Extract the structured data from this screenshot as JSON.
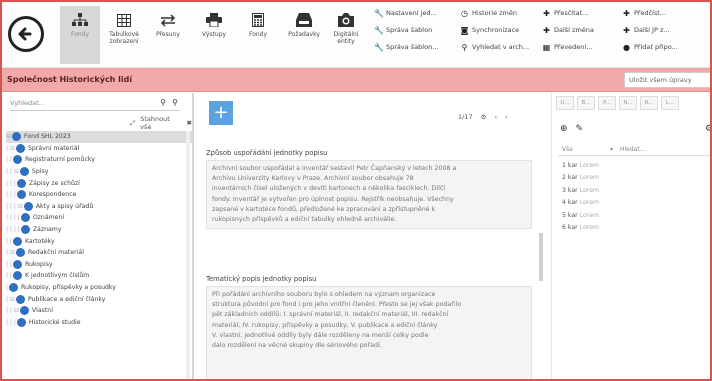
{
  "toolbar": {
    "buttons": [
      {
        "id": "fondy",
        "label": "Fondy",
        "icon": "hierarchy-icon",
        "active": true
      },
      {
        "id": "tabulkove",
        "label": "Tabulkové zobrazení",
        "icon": "table-icon",
        "active": false
      },
      {
        "id": "presuny",
        "label": "Přesuny",
        "icon": "transfer-icon",
        "active": false
      },
      {
        "id": "vystupy",
        "label": "Výstupy",
        "icon": "printer-icon",
        "active": false
      },
      {
        "id": "fondy2",
        "label": "Fondy",
        "icon": "calculator-icon",
        "active": false
      },
      {
        "id": "pozadavky",
        "label": "Požadavky",
        "icon": "inbox-icon",
        "active": false
      },
      {
        "id": "digitalni",
        "label": "Digitální entity",
        "icon": "camera-icon",
        "active": false
      }
    ],
    "menu_columns": [
      [
        {
          "icon": "wrench-icon",
          "label": "Nastavení jed..."
        },
        {
          "icon": "wrench-icon",
          "label": "Správa šablon"
        },
        {
          "icon": "wrench-icon",
          "label": "Správa šablon..."
        }
      ],
      [
        {
          "icon": "clock-icon",
          "label": "Historie změn"
        },
        {
          "icon": "camera-icon",
          "label": "Synchronizace"
        },
        {
          "icon": "search-icon",
          "label": "Vyhledat v arch..."
        }
      ],
      [
        {
          "icon": "plus-icon",
          "label": "Přesčítat..."
        },
        {
          "icon": "plus-icon",
          "label": "Další změna"
        },
        {
          "icon": "calculator-icon",
          "label": "Převedení..."
        }
      ],
      [
        {
          "icon": "plus-icon",
          "label": "Předčíst..."
        },
        {
          "icon": "plus-icon",
          "label": "Další JP z..."
        },
        {
          "icon": "comment-icon",
          "label": "Přidat připo..."
        }
      ]
    ]
  },
  "title_bar": {
    "title": "Společnost Historických lidí",
    "search_placeholder": "Uložit všem úpravy"
  },
  "left_panel": {
    "search_placeholder": "Vyhledat...",
    "tools_label": "Stahnout vše",
    "tree": [
      {
        "prefix": "",
        "label": "Fond SHL 2023",
        "selected": true,
        "toggle": "⊟"
      },
      {
        "prefix": "| ",
        "label": "Správní materiál",
        "toggle": "⊟"
      },
      {
        "prefix": "| | ",
        "label": "Registraturní pomůcky",
        "toggle": ""
      },
      {
        "prefix": "| | ",
        "label": "Spisy",
        "toggle": "⊟"
      },
      {
        "prefix": "| | | ",
        "label": "Zápisy ze schůzí",
        "toggle": ""
      },
      {
        "prefix": "| | | ",
        "label": "Korespondence",
        "toggle": ""
      },
      {
        "prefix": "| | | ",
        "label": "Akty a spisy úřadů",
        "toggle": "⊟"
      },
      {
        "prefix": "| | | | ",
        "label": "Oznámení",
        "toggle": ""
      },
      {
        "prefix": "| | | | ",
        "label": "Záznamy",
        "toggle": ""
      },
      {
        "prefix": "| | ",
        "label": "Kartotéky",
        "toggle": ""
      },
      {
        "prefix": "| ",
        "label": "Redakční materiál",
        "toggle": "⊟"
      },
      {
        "prefix": "| | ",
        "label": "Rukopisy",
        "toggle": ""
      },
      {
        "prefix": "| | ",
        "label": "K jednotlivým číslům",
        "toggle": ""
      },
      {
        "prefix": "| ",
        "label": "Rukopisy, příspěvky a posudky",
        "toggle": ""
      },
      {
        "prefix": "| ",
        "label": "Publikace a ediční články",
        "toggle": "⊟"
      },
      {
        "prefix": "| | ",
        "label": "Vlastní",
        "toggle": "⊟"
      },
      {
        "prefix": "| | | ",
        "label": "Historické studie",
        "toggle": ""
      }
    ]
  },
  "main": {
    "add_label": "+",
    "pager": "1/17",
    "fields": [
      {
        "label": "Způsob uspořádání jednotky popisu",
        "lines": [
          "Archivní soubor uspořádal a inventář sestavil Petr Čapňanský v letech 2008 a",
          "Archivu Univerzity Karlovy v Praze. Archivní soubor obsahuje 78",
          "inventárních čísel uložených v devíti kartonech a několika fasciklech. Dílčí",
          "fondy. Inventář je vytvořen pro úplnost popisu. Rejstřík neobsahuje. Všechny",
          "zapsané v kartotéce fondů, předložené ke zpracování a zpřístupněné k",
          "rukopisných příspěvků a ediční tabulky ohledně archiválie."
        ]
      },
      {
        "label": "Tematický popis jednotky popisu",
        "lines": [
          "Při pořádání archivního souboru bylo s ohledem na význam organizace",
          "struktura původní pro fond i pro jeho vnitřní členění. Přesto se jej však podařilo",
          "pět základních oddílů: I. správní materiál, II. redakční materiál, III. redakční",
          "materiál, IV. rukopisy, příspěvky a posudky, V. publikace a ediční články",
          "V. vlastní, jednotlivé oddíly byly dále rozděleny na menší celky podle",
          "dalo rozdělení na věcné skupiny dle sériového pořadí."
        ]
      }
    ]
  },
  "right_panel": {
    "tabs": [
      "U...",
      "B...",
      "P...",
      "N...",
      "R...",
      "L..."
    ],
    "filter_select": "Vše",
    "filter_placeholder": "Hledat...",
    "rows": [
      {
        "key": "1 kar",
        "val": "Lorem"
      },
      {
        "key": "2 kar",
        "val": "Lorem"
      },
      {
        "key": "3 kar",
        "val": "Lorem"
      },
      {
        "key": "4 kar",
        "val": "Lorem"
      },
      {
        "key": "5 kar",
        "val": "Lorem"
      },
      {
        "key": "6 kar",
        "val": "Lorem"
      }
    ]
  },
  "colors": {
    "accent": "#5ba3e0",
    "title_bar": "#f2a9a9",
    "node_icon": "#2e6fc2",
    "frame": "#d9534f"
  }
}
